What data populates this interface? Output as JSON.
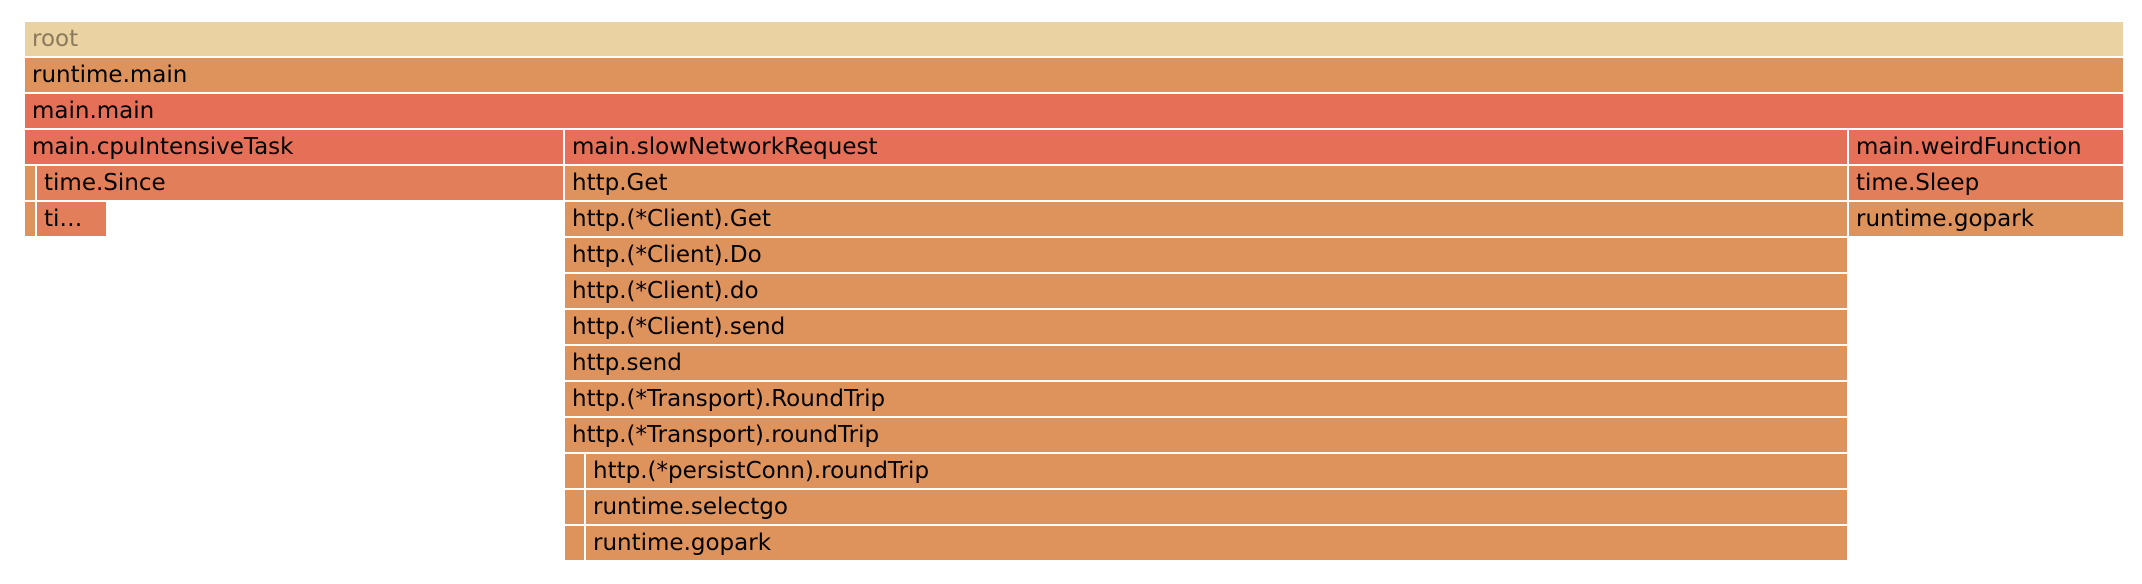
{
  "flamegraph": {
    "colors": {
      "root": "#EBD2A3",
      "light": "#DE935D",
      "mid": "#E27F5A",
      "hot": "#E57057"
    },
    "frames": [
      {
        "id": "root",
        "label": "root",
        "depth": 0,
        "start": 0.0,
        "end": 1.0,
        "color": "root"
      },
      {
        "id": "runtime-main",
        "label": "runtime.main",
        "depth": 1,
        "start": 0.0,
        "end": 1.0,
        "color": "light"
      },
      {
        "id": "main-main",
        "label": "main.main",
        "depth": 2,
        "start": 0.0,
        "end": 1.0,
        "color": "hot"
      },
      {
        "id": "main-cpuintensivetask",
        "label": "main.cpuIntensiveTask",
        "depth": 3,
        "start": 0.0,
        "end": 0.2574,
        "color": "hot"
      },
      {
        "id": "cpu-self-sliver",
        "label": "",
        "depth": 4,
        "start": 0.0,
        "end": 0.0059,
        "color": "light"
      },
      {
        "id": "time-since",
        "label": "time.Since",
        "depth": 4,
        "start": 0.0059,
        "end": 0.2574,
        "color": "mid"
      },
      {
        "id": "cpu-self-sliver-2",
        "label": "",
        "depth": 5,
        "start": 0.0,
        "end": 0.0059,
        "color": "light"
      },
      {
        "id": "ti-truncated",
        "label": "ti…",
        "depth": 5,
        "start": 0.0059,
        "end": 0.0394,
        "color": "mid"
      },
      {
        "id": "main-slownetworkrequest",
        "label": "main.slowNetworkRequest",
        "depth": 3,
        "start": 0.2574,
        "end": 0.8696,
        "color": "hot"
      },
      {
        "id": "http-get",
        "label": "http.Get",
        "depth": 4,
        "start": 0.2574,
        "end": 0.8696,
        "color": "light"
      },
      {
        "id": "http-client-get",
        "label": "http.(*Client).Get",
        "depth": 5,
        "start": 0.2574,
        "end": 0.8696,
        "color": "light"
      },
      {
        "id": "http-client-do-upper",
        "label": "http.(*Client).Do",
        "depth": 6,
        "start": 0.2574,
        "end": 0.8696,
        "color": "light"
      },
      {
        "id": "http-client-do-lower",
        "label": "http.(*Client).do",
        "depth": 7,
        "start": 0.2574,
        "end": 0.8696,
        "color": "light"
      },
      {
        "id": "http-client-send",
        "label": "http.(*Client).send",
        "depth": 8,
        "start": 0.2574,
        "end": 0.8696,
        "color": "light"
      },
      {
        "id": "http-send",
        "label": "http.send",
        "depth": 9,
        "start": 0.2574,
        "end": 0.8696,
        "color": "light"
      },
      {
        "id": "http-transport-roundtrip-upper",
        "label": "http.(*Transport).RoundTrip",
        "depth": 10,
        "start": 0.2574,
        "end": 0.8696,
        "color": "light"
      },
      {
        "id": "http-transport-roundtrip-lower",
        "label": "http.(*Transport).roundTrip",
        "depth": 11,
        "start": 0.2574,
        "end": 0.8696,
        "color": "light"
      },
      {
        "id": "transport-self-sliver-1",
        "label": "",
        "depth": 12,
        "start": 0.2574,
        "end": 0.2673,
        "color": "light"
      },
      {
        "id": "http-persistconn-roundtrip",
        "label": "http.(*persistConn).roundTrip",
        "depth": 12,
        "start": 0.2673,
        "end": 0.8696,
        "color": "light"
      },
      {
        "id": "transport-self-sliver-2",
        "label": "",
        "depth": 13,
        "start": 0.2574,
        "end": 0.2673,
        "color": "light"
      },
      {
        "id": "runtime-selectgo",
        "label": "runtime.selectgo",
        "depth": 13,
        "start": 0.2673,
        "end": 0.8696,
        "color": "light"
      },
      {
        "id": "transport-self-sliver-3",
        "label": "",
        "depth": 14,
        "start": 0.2574,
        "end": 0.2673,
        "color": "light"
      },
      {
        "id": "runtime-gopark-network",
        "label": "runtime.gopark",
        "depth": 14,
        "start": 0.2673,
        "end": 0.8696,
        "color": "light"
      },
      {
        "id": "main-weirdfunction",
        "label": "main.weirdFunction",
        "depth": 3,
        "start": 0.8696,
        "end": 1.0,
        "color": "hot"
      },
      {
        "id": "time-sleep",
        "label": "time.Sleep",
        "depth": 4,
        "start": 0.8696,
        "end": 1.0,
        "color": "mid"
      },
      {
        "id": "runtime-gopark-weird",
        "label": "runtime.gopark",
        "depth": 5,
        "start": 0.8696,
        "end": 1.0,
        "color": "light"
      }
    ]
  }
}
